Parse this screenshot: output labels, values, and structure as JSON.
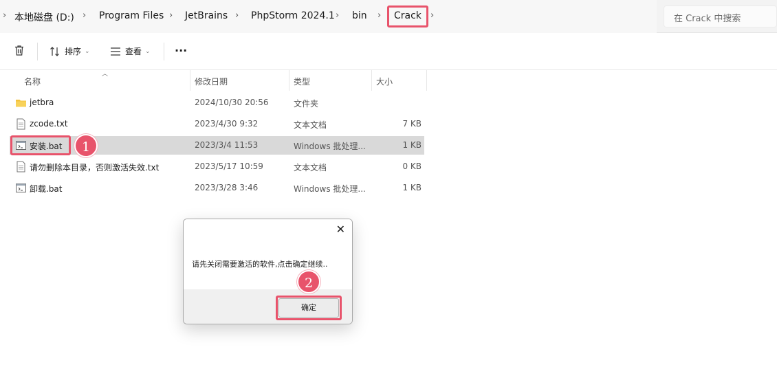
{
  "breadcrumb": {
    "items": [
      "本地磁盘 (D:)",
      "Program Files",
      "JetBrains",
      "PhpStorm 2024.1",
      "bin",
      "Crack"
    ],
    "separator": "›"
  },
  "search": {
    "placeholder": "在 Crack 中搜索"
  },
  "toolbar": {
    "delete_icon": "trash-icon",
    "sort_label": "排序",
    "view_label": "查看",
    "more_label": "···"
  },
  "columns": {
    "name": "名称",
    "date": "修改日期",
    "type": "类型",
    "size": "大小"
  },
  "files": [
    {
      "icon": "folder-icon",
      "name": "jetbra",
      "date": "2024/10/30 20:56",
      "type": "文件夹",
      "size": ""
    },
    {
      "icon": "text-file-icon",
      "name": "zcode.txt",
      "date": "2023/4/30 9:32",
      "type": "文本文档",
      "size": "7 KB"
    },
    {
      "icon": "batch-file-icon",
      "name": "安装.bat",
      "date": "2023/3/4 11:53",
      "type": "Windows 批处理...",
      "size": "1 KB"
    },
    {
      "icon": "text-file-icon",
      "name": "请勿删除本目录，否则激活失效.txt",
      "date": "2023/5/17 10:59",
      "type": "文本文档",
      "size": "0 KB"
    },
    {
      "icon": "batch-file-icon",
      "name": "卸载.bat",
      "date": "2023/3/28 3:46",
      "type": "Windows 批处理...",
      "size": "1 KB"
    }
  ],
  "badges": {
    "step1": "1",
    "step2": "2"
  },
  "dialog": {
    "close_glyph": "✕",
    "message": "请先关闭需要激活的软件,点击确定继续..",
    "ok_label": "确定"
  },
  "colors": {
    "highlight": "#e8536b",
    "selected_row": "#d9d9d9",
    "folder": "#f3c13a"
  }
}
